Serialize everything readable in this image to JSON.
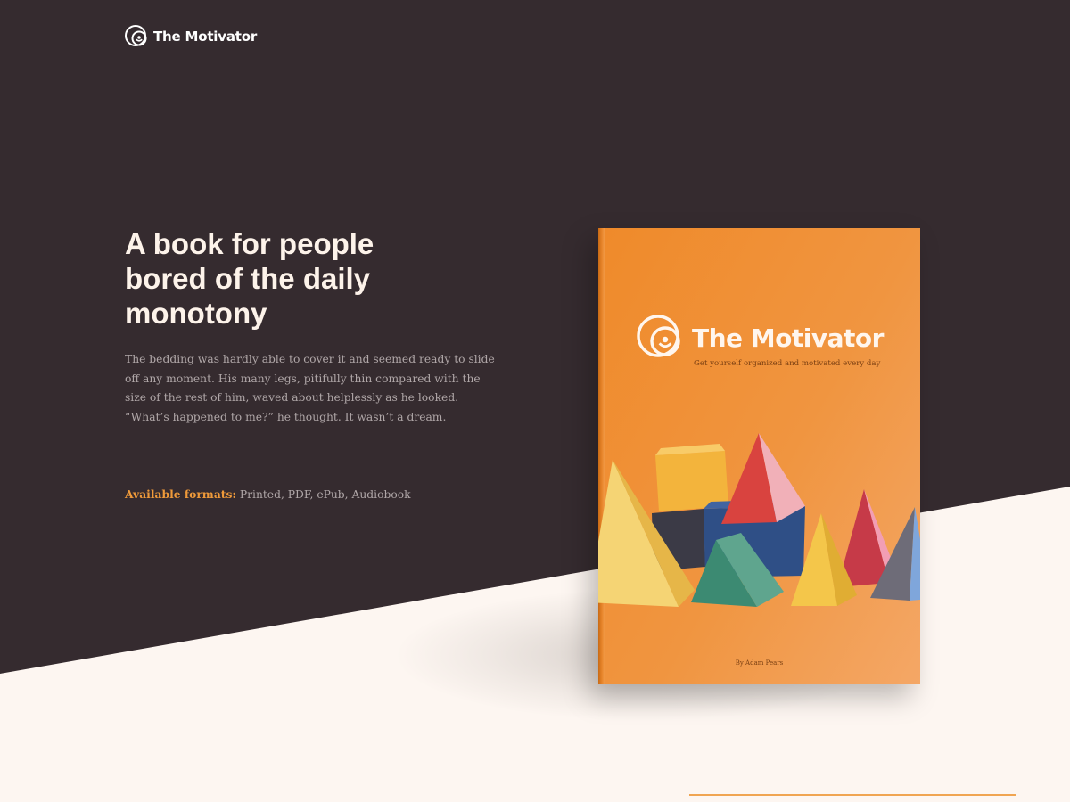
{
  "brand": {
    "name": "The Motivator",
    "logo_icon": "circle-target-logo-icon"
  },
  "hero": {
    "headline_lines": [
      "A book for people",
      "bored of the daily",
      "monotony"
    ],
    "intro": "The bedding was hardly able to cover it and seemed ready to slide off any moment. His many legs, pitifully thin compared with the size of the rest of him, waved about helplessly as he looked. “What’s happened to me?” he thought. It wasn’t a dream.",
    "formats_label": "Available formats:",
    "formats_value": "Printed, PDF, ePub, Audiobook"
  },
  "book": {
    "title": "The Motivator",
    "tagline": "Get yourself organized and motivated every day",
    "author": "By Adam Pears"
  },
  "colors": {
    "hero_bg": "#352b2f",
    "page_bg": "#fdf6f1",
    "accent": "#ef9a3a",
    "book_cover": "#f08f33"
  }
}
